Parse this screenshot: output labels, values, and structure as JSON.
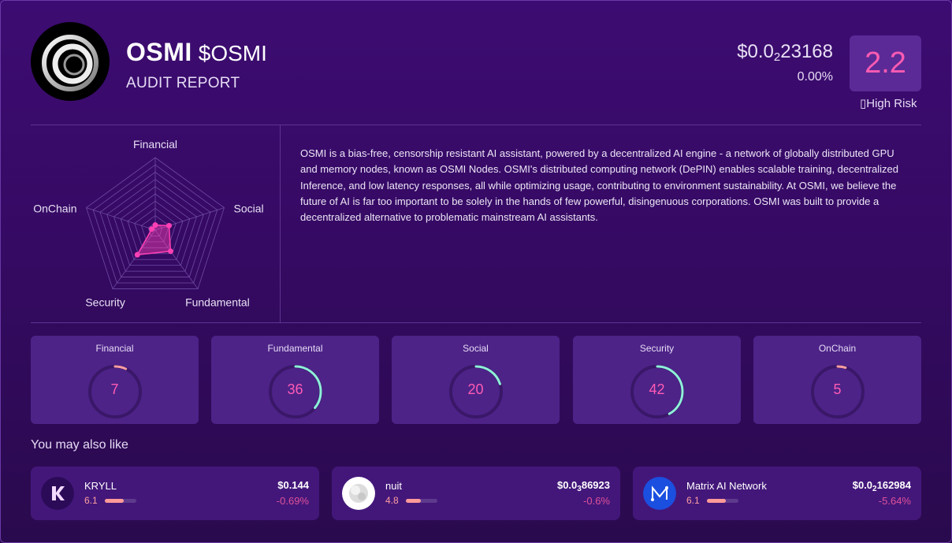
{
  "header": {
    "name": "OSMI",
    "ticker": "$OSMI",
    "subtitle": "AUDIT REPORT",
    "price_prefix": "$0.0",
    "price_zeros": "2",
    "price_digits": "23168",
    "change": "0.00%",
    "score": "2.2",
    "risk_label": "High Risk"
  },
  "radar": {
    "axes": [
      "Financial",
      "Social",
      "Fundamental",
      "Security",
      "OnChain"
    ],
    "values": [
      7,
      20,
      36,
      42,
      5
    ],
    "max": 100,
    "color": "#ff3fb4"
  },
  "description": "OSMI is a bias-free, censorship resistant AI assistant, powered by a decentralized AI engine - a network of globally distributed GPU and memory nodes, known as OSMI Nodes. OSMI's distributed computing network (DePIN) enables scalable training, decentralized Inference, and low latency responses, all while optimizing usage, contributing to environment sustainability. At OSMI, we believe the future of AI is far too important to be solely in the hands of few powerful, disingenuous corporations. OSMI was built to provide a decentralized alternative to problematic mainstream AI assistants.",
  "scores": [
    {
      "label": "Financial",
      "value": 7,
      "color": "#ff9fa0"
    },
    {
      "label": "Fundamental",
      "value": 36,
      "color": "#8ef0d8"
    },
    {
      "label": "Social",
      "value": 20,
      "color": "#8ef0d8"
    },
    {
      "label": "Security",
      "value": 42,
      "color": "#8ef0d8"
    },
    {
      "label": "OnChain",
      "value": 5,
      "color": "#ff9fa0"
    }
  ],
  "related_title": "You may also like",
  "related": [
    {
      "name": "KRYLL",
      "score": "6.1",
      "score_fraction": 0.61,
      "price_prefix": "$0.144",
      "price_zeros": "",
      "price_digits": "",
      "change": "-0.69%",
      "icon": "kryll-logo-icon"
    },
    {
      "name": "nuit",
      "score": "4.8",
      "score_fraction": 0.48,
      "price_prefix": "$0.0",
      "price_zeros": "3",
      "price_digits": "86923",
      "change": "-0.6%",
      "icon": "nuit-logo-icon"
    },
    {
      "name": "Matrix AI Network",
      "score": "6.1",
      "score_fraction": 0.61,
      "price_prefix": "$0.0",
      "price_zeros": "2",
      "price_digits": "162984",
      "change": "-5.64%",
      "icon": "matrix-ai-logo-icon"
    }
  ]
}
